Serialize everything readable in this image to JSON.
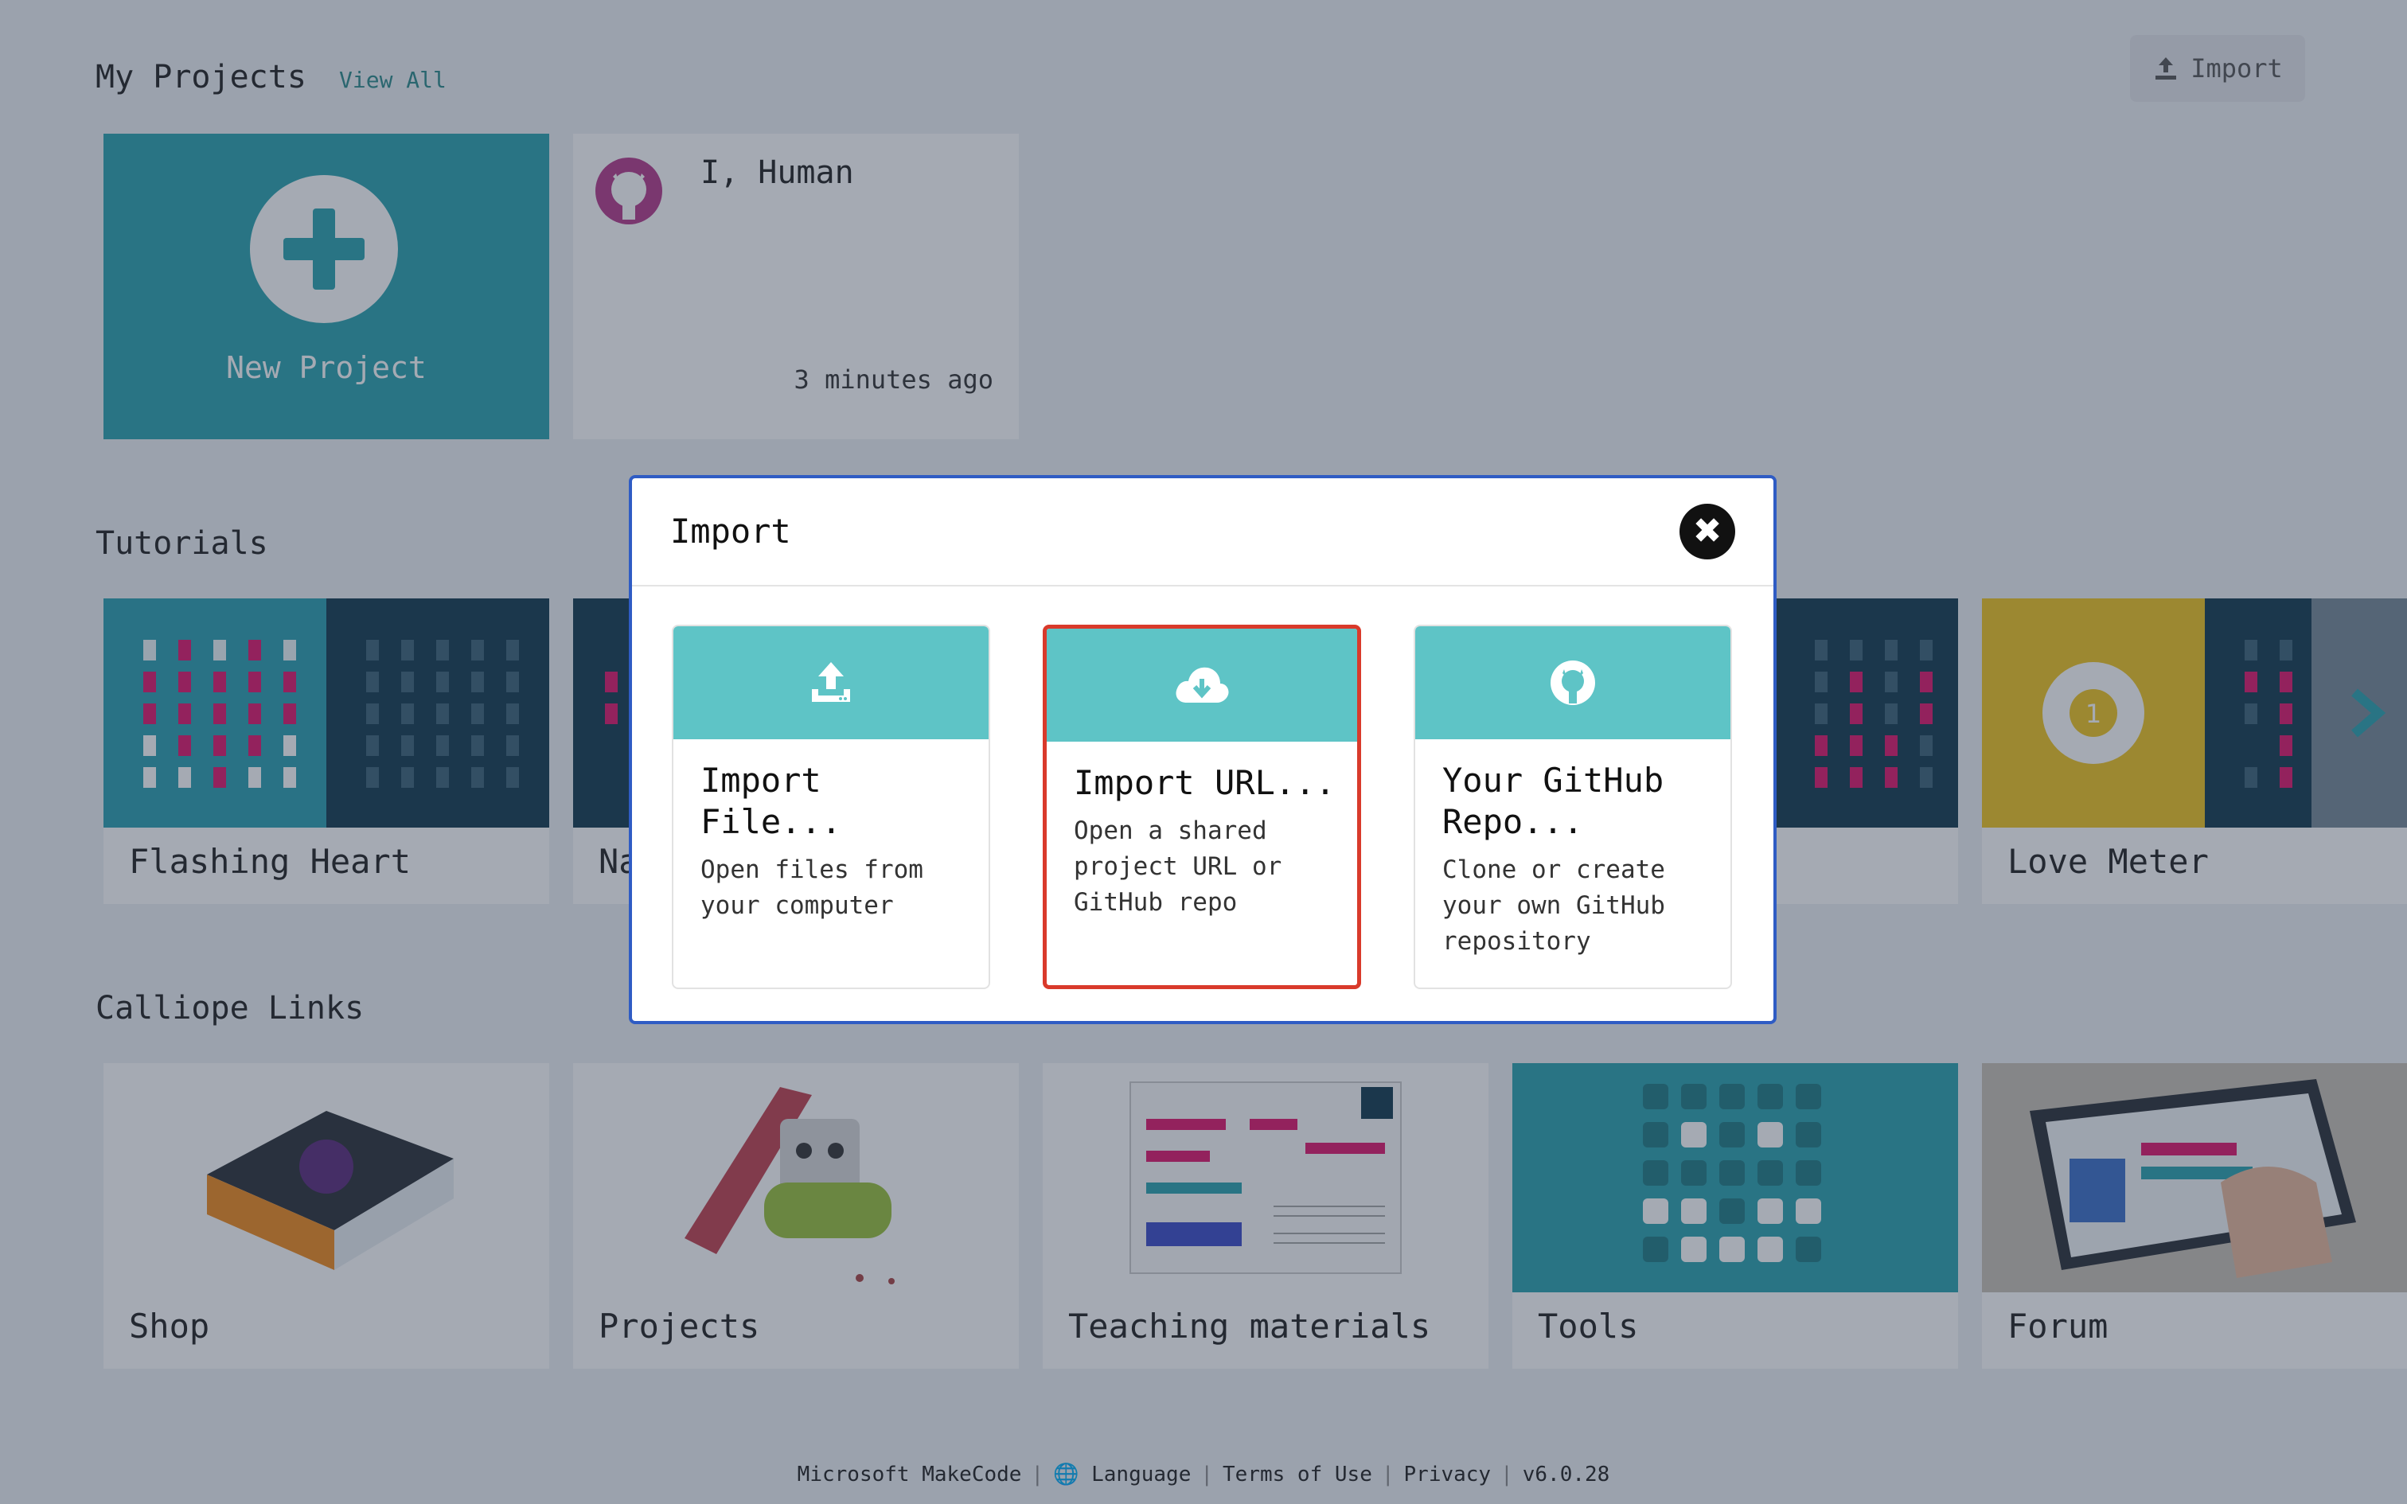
{
  "header": {
    "my_projects": "My Projects",
    "view_all": "View All",
    "import_button": "Import"
  },
  "projects": {
    "new_project": "New Project",
    "items": [
      {
        "title": "I, Human",
        "time": "3 minutes ago"
      }
    ]
  },
  "tutorials": {
    "title": "Tutorials",
    "items": [
      {
        "label": "Flashing Heart"
      },
      {
        "label": "Na"
      },
      {
        "label": "Love Meter"
      }
    ]
  },
  "links": {
    "title": "Calliope Links",
    "items": [
      {
        "label": "Shop"
      },
      {
        "label": "Projects"
      },
      {
        "label": "Teaching materials"
      },
      {
        "label": "Tools"
      },
      {
        "label": "Forum"
      }
    ]
  },
  "footer": {
    "makecode": "Microsoft MakeCode",
    "language": "Language",
    "terms": "Terms of Use",
    "privacy": "Privacy",
    "version": "v6.0.28"
  },
  "modal": {
    "title": "Import",
    "close_icon": "close-icon",
    "options": [
      {
        "title": "Import File...",
        "desc": "Open files from your computer",
        "icon": "upload-icon"
      },
      {
        "title": "Import URL...",
        "desc": "Open a shared project URL or GitHub repo",
        "icon": "cloud-download-icon"
      },
      {
        "title": "Your GitHub Repo...",
        "desc": "Clone or create your own GitHub repository",
        "icon": "github-icon"
      }
    ]
  },
  "colors": {
    "accent": "#2aa3ae",
    "option_header": "#5ec4c6",
    "selected_border": "#d93a2b",
    "modal_border": "#2f5cc4"
  }
}
